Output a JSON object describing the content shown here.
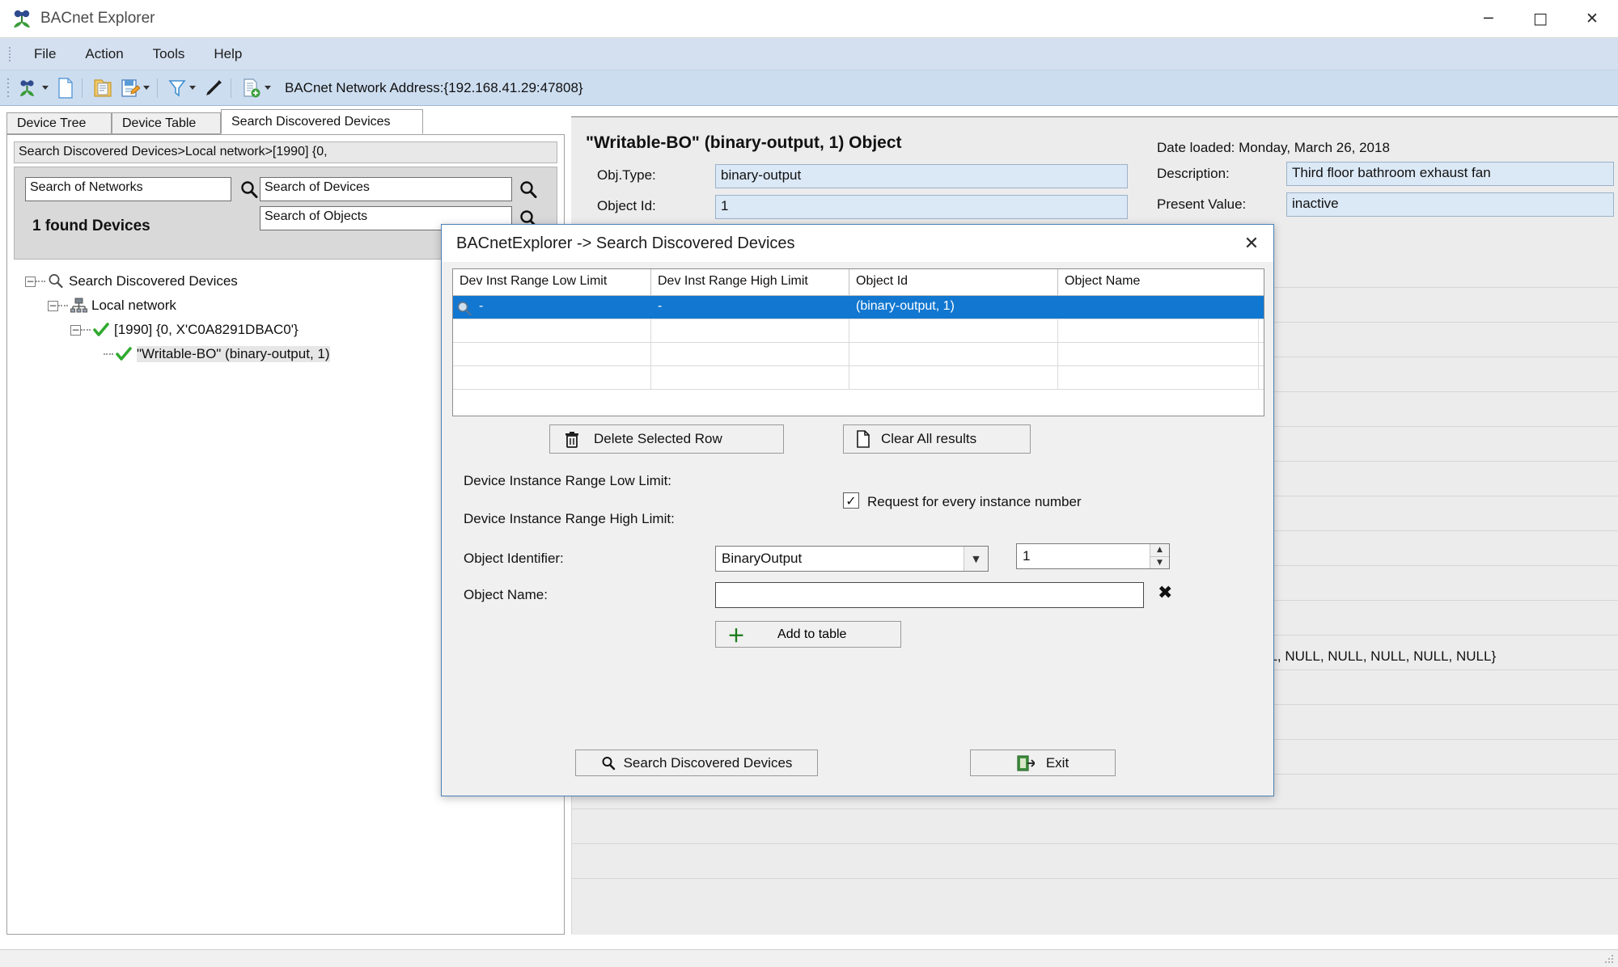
{
  "window": {
    "title": "BACnet Explorer",
    "icon": "binoculars-icon",
    "minimize": "─",
    "maximize": "□",
    "close": "✕"
  },
  "menu": {
    "items": [
      {
        "label": "File"
      },
      {
        "label": "Action"
      },
      {
        "label": "Tools"
      },
      {
        "label": "Help"
      }
    ]
  },
  "toolbar": {
    "address": "BACnet Network Address:{192.168.41.29:47808}",
    "buttons": [
      {
        "name": "discover-icon"
      },
      {
        "name": "new-file-icon"
      },
      {
        "name": "open-folder-icon"
      },
      {
        "name": "save-icon"
      },
      {
        "name": "filter-icon"
      },
      {
        "name": "pen-icon"
      },
      {
        "name": "add-document-icon"
      }
    ]
  },
  "tabs": [
    {
      "label": "Device Tree",
      "active": false
    },
    {
      "label": "Device Table",
      "active": false
    },
    {
      "label": "Search Discovered Devices",
      "active": true
    }
  ],
  "left_panel": {
    "breadcrumb": "Search Discovered Devices>Local network>[1990] {0,",
    "search_networks": {
      "value": "Search of Networks"
    },
    "search_devices": {
      "value": "Search of Devices"
    },
    "search_objects": {
      "value": "Search of Objects"
    },
    "found_label": "1 found Devices",
    "tree": [
      {
        "label": "Search Discovered Devices",
        "icon": "magnifier-icon",
        "depth": 0,
        "expander": "−"
      },
      {
        "label": "Local network",
        "icon": "network-icon",
        "depth": 1,
        "expander": "−"
      },
      {
        "label": "[1990] {0, X'C0A8291DBAC0'}",
        "icon": "green-check-icon",
        "depth": 2,
        "expander": "−"
      },
      {
        "label": "\"Writable-BO\" (binary-output, 1)",
        "icon": "green-check-icon",
        "depth": 3,
        "expander": ""
      }
    ]
  },
  "object_panel": {
    "title": "\"Writable-BO\" (binary-output, 1) Object",
    "date_loaded": "Date loaded: Monday, March 26, 2018",
    "fields": [
      {
        "label": "Obj.Type:",
        "value": "binary-output"
      },
      {
        "label": "Object Id:",
        "value": "1"
      }
    ],
    "right_fields": [
      {
        "label": "Description:",
        "value": "Third floor bathroom exhaust fan"
      },
      {
        "label": "Present Value:",
        "value": "inactive"
      }
    ],
    "null_row": "LL, NULL, NULL, NULL, NULL, NULL}"
  },
  "dialog": {
    "title": "BACnetExplorer -> Search Discovered Devices",
    "close_icon": "✕",
    "grid": {
      "columns": [
        "Dev Inst Range Low Limit",
        "Dev Inst Range High Limit",
        "Object Id",
        "Object Name"
      ],
      "rows": [
        {
          "selected": true,
          "cells": [
            "-",
            "-",
            "(binary-output, 1)",
            ""
          ]
        },
        {
          "selected": false,
          "cells": [
            "",
            "",
            "",
            ""
          ]
        },
        {
          "selected": false,
          "cells": [
            "",
            "",
            "",
            ""
          ]
        },
        {
          "selected": false,
          "cells": [
            "",
            "",
            "",
            ""
          ]
        }
      ]
    },
    "delete_row_button": "Delete Selected Row",
    "clear_all_button": "Clear All results",
    "low_limit_label": "Device Instance Range Low Limit:",
    "high_limit_label": "Device Instance Range High Limit:",
    "checkbox": {
      "label": "Request for every instance number",
      "checked": true,
      "mark": "✓"
    },
    "object_identifier_label": "Object Identifier:",
    "object_identifier_value": "BinaryOutput",
    "object_identifier_arrow": "▼",
    "instance_number_value": "1",
    "spinner_up": "▲",
    "spinner_down": "▼",
    "object_name_label": "Object Name:",
    "object_name_value": "",
    "clear_name_icon": "✖",
    "add_to_table_button": "Add to table",
    "add_icon": "＋",
    "search_button": "Search Discovered Devices",
    "search_icon": "search-icon",
    "exit_button": "Exit",
    "exit_icon": "exit-door-icon"
  },
  "colors": {
    "accent_blue": "#1177d1",
    "menu_bg": "#d4e0f0",
    "toolbar_bg": "#cdddf0",
    "field_blue": "#dbe8f5",
    "dialog_border": "#4b7fb5",
    "green_check": "#2faa2f"
  }
}
